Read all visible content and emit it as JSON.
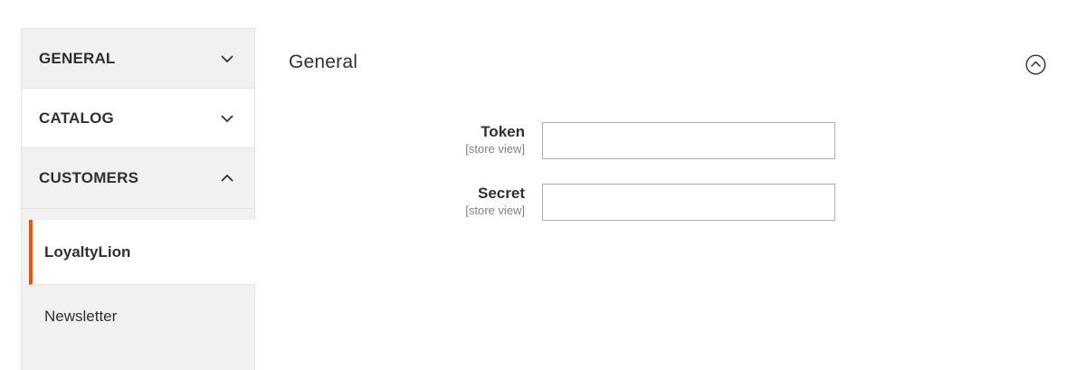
{
  "sidebar": {
    "sections": [
      {
        "label": "GENERAL",
        "state": "collapsed"
      },
      {
        "label": "CATALOG",
        "state": "collapsed"
      },
      {
        "label": "CUSTOMERS",
        "state": "expanded"
      }
    ],
    "customer_items": [
      {
        "label": "LoyaltyLion",
        "active": true
      },
      {
        "label": "Newsletter",
        "active": false
      }
    ],
    "accent_color": "#eb5202"
  },
  "main": {
    "section_title": "General",
    "fields": [
      {
        "label": "Token",
        "scope": "[store view]",
        "value": "",
        "placeholder": ""
      },
      {
        "label": "Secret",
        "scope": "[store view]",
        "value": "",
        "placeholder": ""
      }
    ]
  },
  "icons": {
    "section_chevron_collapsed": "chevron-down-icon",
    "section_chevron_expanded": "chevron-up-icon",
    "collapse_button": "circle-chevron-up-icon"
  }
}
